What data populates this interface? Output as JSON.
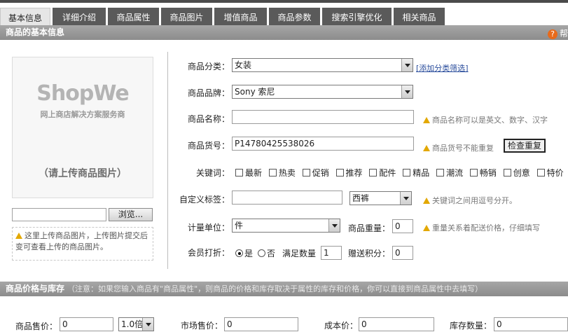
{
  "tabs": [
    "基本信息",
    "详细介绍",
    "商品属性",
    "商品图片",
    "增值商品",
    "商品参数",
    "搜索引擎优化",
    "相关商品"
  ],
  "basic_section": {
    "title": "商品的基本信息",
    "help": "帮"
  },
  "image_panel": {
    "logo": "ShopWe",
    "slogan": "网上商店解决方案服务商",
    "placeholder": "（请上传商品图片）",
    "browse_label": "浏览...",
    "tip": "这里上传商品图片，上传图片提交后变可查看上传的商品图片。"
  },
  "form": {
    "category": {
      "label": "商品分类：",
      "value": "女装",
      "link": "[添加分类筛选]"
    },
    "brand": {
      "label": "商品品牌：",
      "value": "Sony 索尼"
    },
    "name": {
      "label": "商品名称：",
      "value": "",
      "hint": "商品名称可以是英文、数字、汉字"
    },
    "sku": {
      "label": "商品货号：",
      "value": "P14780425538026",
      "hint": "商品货号不能重复",
      "check_button": "检查重复"
    },
    "keywords": {
      "label": "关键词：",
      "options": [
        "最新",
        "热卖",
        "促销",
        "推荐",
        "配件",
        "精品",
        "潮流",
        "畅销",
        "创意",
        "特价"
      ]
    },
    "custom_tag": {
      "label": "自定义标签：",
      "value": "",
      "select_value": "西裤",
      "hint": "关键词之间用逗号分开。"
    },
    "unit": {
      "label": "计量单位：",
      "value": "件",
      "weight_label": "商品重量：",
      "weight_value": "0",
      "hint": "重量关系着配送价格，仔细填写"
    },
    "member_discount": {
      "label": "会员打折：",
      "yes": "是",
      "no": "否",
      "qty_label": "满足数量",
      "qty_value": "1",
      "points_label": "赠送积分：",
      "points_value": "0"
    }
  },
  "price_section": {
    "title": "商品价格与库存",
    "note": "（注意：如果您输入商品有\"商品属性\"，则商品的价格和库存取决于属性的库存和价格，你可以直接到商品属性中去填写）",
    "sale_price_label": "商品售价：",
    "sale_price_value": "0",
    "multiplier": "1.0倍",
    "market_price_label": "市场售价：",
    "market_price_value": "0",
    "cost_price_label": "成本价：",
    "cost_price_value": "0",
    "stock_label": "库存数量：",
    "stock_value": "0"
  }
}
